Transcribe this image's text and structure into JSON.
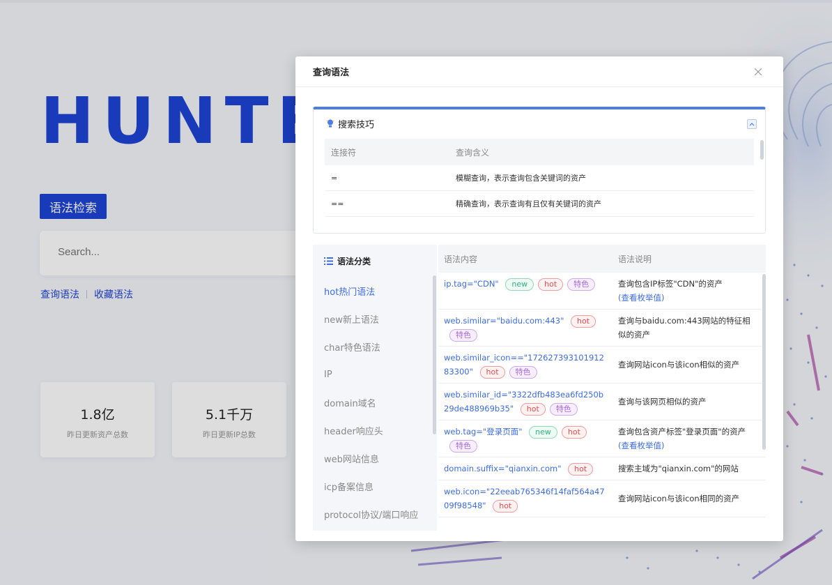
{
  "background": {
    "logo_text": "HUNTER",
    "syntax_search_button": "语法检索",
    "search_placeholder": "Search...",
    "links": {
      "query_syntax": "查询语法",
      "favorite_syntax": "收藏语法"
    },
    "stats": [
      {
        "value": "1.8亿",
        "label": "昨日更新资产总数"
      },
      {
        "value": "5.1千万",
        "label": "昨日更新IP总数"
      }
    ]
  },
  "modal": {
    "title": "查询语法",
    "close_icon": "close-icon",
    "tips": {
      "title": "搜索技巧",
      "columns": [
        "连接符",
        "查询含义"
      ],
      "rows": [
        {
          "op": "=",
          "meaning": "模糊查询，表示查询包含关键词的资产"
        },
        {
          "op": "==",
          "meaning": "精确查询，表示查询有且仅有关键词的资产"
        }
      ]
    },
    "categories": {
      "title": "语法分类",
      "items": [
        "hot热门语法",
        "new新上语法",
        "char特色语法",
        "IP",
        "domain域名",
        "header响应头",
        "web网站信息",
        "icp备案信息",
        "protocol协议/端口响应"
      ],
      "active_index": 0
    },
    "syntax_table": {
      "columns": [
        "语法内容",
        "语法说明"
      ],
      "rows": [
        {
          "content": "ip.tag=\"CDN\"",
          "tags": [
            "new",
            "hot",
            "特色"
          ],
          "desc": "查询包含IP标签\"CDN\"的资产",
          "link": "(查看枚举值)"
        },
        {
          "content": "web.similar=\"baidu.com:443\"",
          "tags": [
            "hot",
            "特色"
          ],
          "desc": "查询与baidu.com:443网站的特征相似的资产",
          "link": ""
        },
        {
          "content": "web.similar_icon==\"17262739310191283300\"",
          "tags": [
            "hot",
            "特色"
          ],
          "desc": "查询网站icon与该icon相似的资产",
          "link": ""
        },
        {
          "content": "web.similar_id=\"3322dfb483ea6fd250b29de488969b35\"",
          "tags": [
            "hot",
            "特色"
          ],
          "desc": "查询与该网页相似的资产",
          "link": ""
        },
        {
          "content": "web.tag=\"登录页面\"",
          "tags": [
            "new",
            "hot",
            "特色"
          ],
          "desc": "查询包含资产标签\"登录页面\"的资产",
          "link": "(查看枚举值)"
        },
        {
          "content": "domain.suffix=\"qianxin.com\"",
          "tags": [
            "hot"
          ],
          "desc": "搜索主域为\"qianxin.com\"的网站",
          "link": ""
        },
        {
          "content": "web.icon=\"22eeab765346f14faf564a4709f98548\"",
          "tags": [
            "hot"
          ],
          "desc": "查询网站icon与该icon相同的资产",
          "link": ""
        }
      ]
    }
  },
  "colors": {
    "accent": "#1f45d6",
    "link": "#3d6ce0",
    "new": "#2db47d",
    "hot": "#e54d4d",
    "special": "#a86bd8"
  }
}
